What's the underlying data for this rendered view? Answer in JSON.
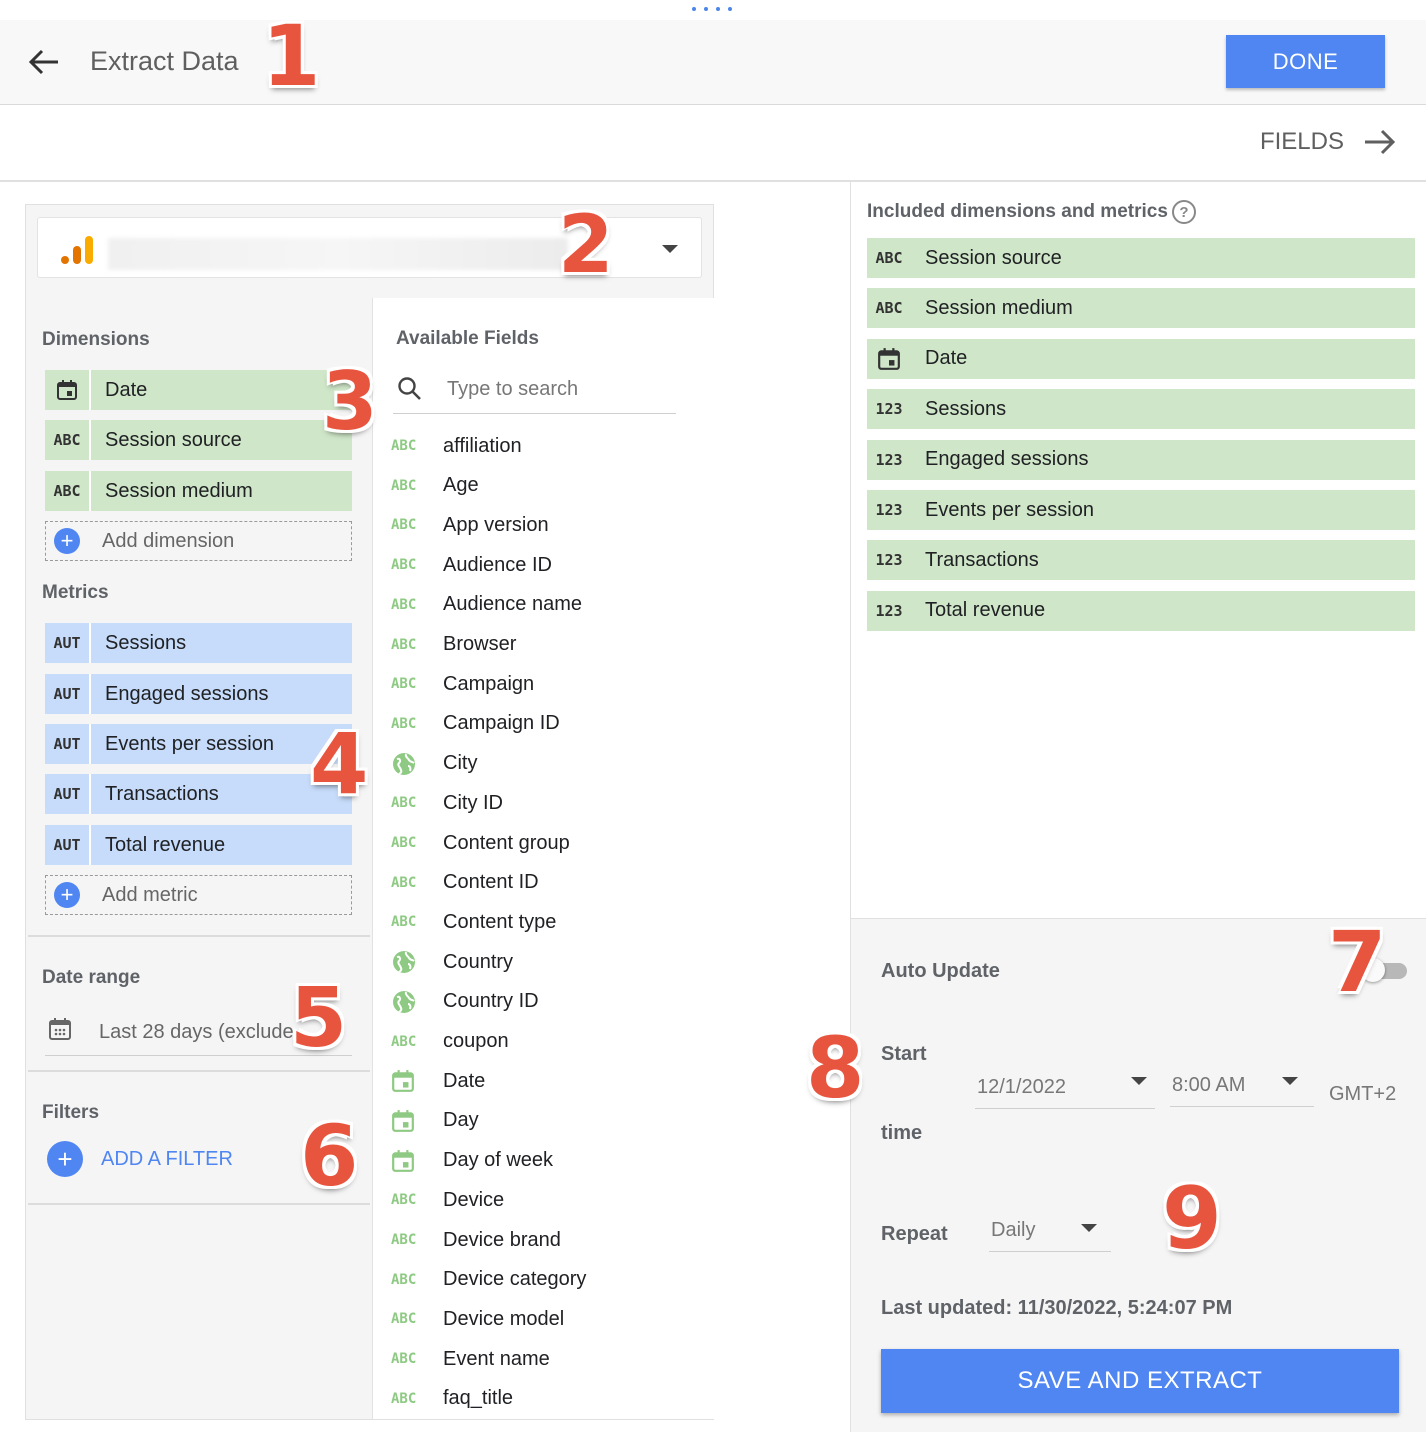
{
  "header": {
    "title": "Extract Data",
    "done_label": "DONE",
    "fields_label": "FIELDS"
  },
  "badges": [
    "1",
    "2",
    "3",
    "4",
    "5",
    "6",
    "7",
    "8",
    "9"
  ],
  "left": {
    "dimensions_label": "Dimensions",
    "dimensions": [
      {
        "type": "calendar-icon",
        "label": "Date"
      },
      {
        "type": "ABC",
        "label": "Session source"
      },
      {
        "type": "ABC",
        "label": "Session medium"
      }
    ],
    "add_dimension": "Add dimension",
    "metrics_label": "Metrics",
    "metrics": [
      {
        "type": "AUT",
        "label": "Sessions"
      },
      {
        "type": "AUT",
        "label": "Engaged sessions"
      },
      {
        "type": "AUT",
        "label": "Events per session"
      },
      {
        "type": "AUT",
        "label": "Transactions"
      },
      {
        "type": "AUT",
        "label": "Total revenue"
      }
    ],
    "add_metric": "Add metric",
    "date_range_label": "Date range",
    "date_range_value": "Last 28 days (exclude",
    "filters_label": "Filters",
    "add_filter": "ADD A FILTER"
  },
  "available": {
    "title": "Available Fields",
    "search_placeholder": "Type to search",
    "fields": [
      {
        "type": "ABC",
        "label": "affiliation"
      },
      {
        "type": "ABC",
        "label": "Age"
      },
      {
        "type": "ABC",
        "label": "App version"
      },
      {
        "type": "ABC",
        "label": "Audience ID"
      },
      {
        "type": "ABC",
        "label": "Audience name"
      },
      {
        "type": "ABC",
        "label": "Browser"
      },
      {
        "type": "ABC",
        "label": "Campaign"
      },
      {
        "type": "ABC",
        "label": "Campaign ID"
      },
      {
        "type": "globe",
        "label": "City"
      },
      {
        "type": "ABC",
        "label": "City ID"
      },
      {
        "type": "ABC",
        "label": "Content group"
      },
      {
        "type": "ABC",
        "label": "Content ID"
      },
      {
        "type": "ABC",
        "label": "Content type"
      },
      {
        "type": "globe",
        "label": "Country"
      },
      {
        "type": "globe",
        "label": "Country ID"
      },
      {
        "type": "ABC",
        "label": "coupon"
      },
      {
        "type": "calendar",
        "label": "Date"
      },
      {
        "type": "calendar",
        "label": "Day"
      },
      {
        "type": "calendar",
        "label": "Day of week"
      },
      {
        "type": "ABC",
        "label": "Device"
      },
      {
        "type": "ABC",
        "label": "Device brand"
      },
      {
        "type": "ABC",
        "label": "Device category"
      },
      {
        "type": "ABC",
        "label": "Device model"
      },
      {
        "type": "ABC",
        "label": "Event name"
      },
      {
        "type": "ABC",
        "label": "faq_title"
      }
    ]
  },
  "included": {
    "title": "Included dimensions and metrics",
    "help_glyph": "?",
    "rows": [
      {
        "type": "ABC",
        "label": "Session source"
      },
      {
        "type": "ABC",
        "label": "Session medium"
      },
      {
        "type": "calendar",
        "label": "Date"
      },
      {
        "type": "123",
        "label": "Sessions"
      },
      {
        "type": "123",
        "label": "Engaged sessions"
      },
      {
        "type": "123",
        "label": "Events per session"
      },
      {
        "type": "123",
        "label": "Transactions"
      },
      {
        "type": "123",
        "label": "Total revenue"
      }
    ]
  },
  "settings": {
    "auto_update_label": "Auto Update",
    "auto_update_on": false,
    "start_label": "Start",
    "time_label": "time",
    "start_date": "12/1/2022",
    "start_time": "8:00 AM",
    "timezone": "GMT+2",
    "repeat_label": "Repeat",
    "repeat_value": "Daily",
    "last_updated": "Last updated: 11/30/2022, 5:24:07 PM",
    "save_label": "SAVE AND EXTRACT"
  },
  "colors": {
    "accent": "#4f86f2",
    "dimension_chip": "#cfe6c8",
    "metric_chip": "#c6dcfa",
    "badge": "#e8553f"
  }
}
